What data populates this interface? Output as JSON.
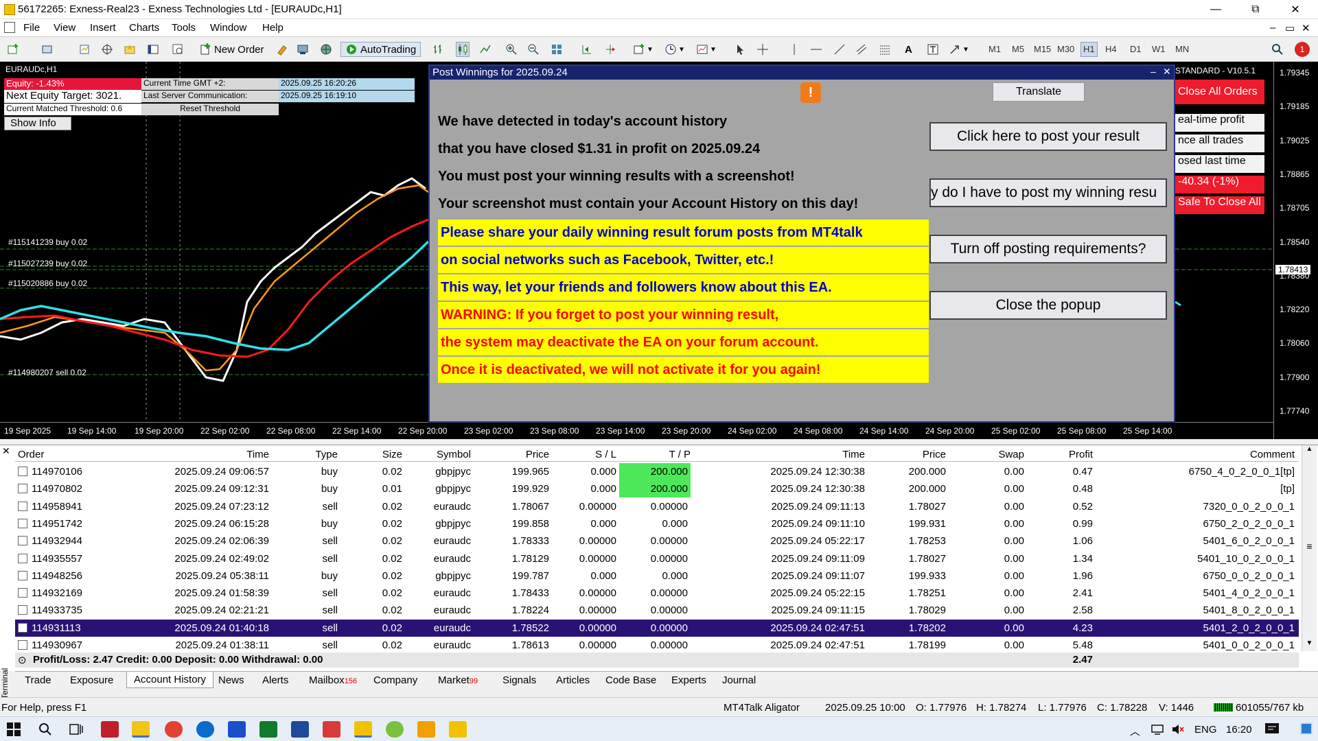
{
  "window": {
    "title": "56172265: Exness-Real23 - Exness Technologies Ltd - [EURAUDc,H1]",
    "buttons": [
      "—",
      "⧉",
      "✕"
    ]
  },
  "menu": [
    "File",
    "View",
    "Insert",
    "Charts",
    "Tools",
    "Window",
    "Help"
  ],
  "toolbar": {
    "new_order": "New Order",
    "autotrading": "AutoTrading",
    "timeframes": [
      "M1",
      "M5",
      "M15",
      "M30",
      "H1",
      "H4",
      "D1",
      "W1",
      "MN"
    ],
    "active_timeframe": "H1",
    "notification_count": "1"
  },
  "chart": {
    "symbol": "EURAUDc,H1",
    "equity": "Equity: -1.43%",
    "next_equity_target": "Next Equity Target: 3021.",
    "matched_threshold": "Current Matched Threshold: 0.6",
    "show_info": "Show Info",
    "current_time_label": "Current Time GMT +2:",
    "current_time_value": "2025.09.25 16:20:26",
    "last_server_label": "Last Server Communication:",
    "last_server_value": "2025.09.25 16:19:10",
    "reset_threshold": "Reset Threshold",
    "trade_labels": [
      "#115141239 buy 0.02",
      "#115027239 buy 0.02",
      "#115020886 buy 0.02",
      "#114980207 sell 0.02"
    ],
    "ea_version": "STANDARD - V10.5.1",
    "side_buttons": [
      "Close All Orders",
      "eal-time profit",
      "nce all trades",
      "osed last time",
      "-40.34 (-1%)",
      "Safe To Close All"
    ],
    "price_labels": [
      "1.79345",
      "1.79185",
      "1.79025",
      "1.78865",
      "1.78705",
      "1.78540",
      "1.78413",
      "1.78380",
      "1.78220",
      "1.78060",
      "1.77900",
      "1.77740"
    ],
    "current_price": "1.78413",
    "date_labels": [
      "19 Sep 2025",
      "19 Sep 14:00",
      "19 Sep 20:00",
      "22 Sep 02:00",
      "22 Sep 08:00",
      "22 Sep 14:00",
      "22 Sep 20:00",
      "23 Sep 02:00",
      "23 Sep 08:00",
      "23 Sep 14:00",
      "23 Sep 20:00",
      "24 Sep 02:00",
      "24 Sep 08:00",
      "24 Sep 14:00",
      "24 Sep 20:00",
      "25 Sep 02:00",
      "25 Sep 08:00",
      "25 Sep 14:00"
    ]
  },
  "popup": {
    "title": "Post Winnings for 2025.09.24",
    "translate": "Translate",
    "lines": [
      "We have detected in today's account history",
      "that you have closed $1.31 in profit on 2025.09.24",
      "You must post your winning results with a screenshot!",
      "Your screenshot must contain your Account History on this day!"
    ],
    "blue_lines": [
      "Please share your daily winning result forum posts from MT4talk",
      "on social networks such as Facebook, Twitter, etc.!",
      "This way, let your friends and followers know about this EA."
    ],
    "red_lines": [
      "WARNING: If you forget to post your winning result,",
      "the system may deactivate the EA on your forum account.",
      "Once it is deactivated, we will not activate it for you again!"
    ],
    "buttons": {
      "post": "Click here to post your result",
      "why": "y do I have to post my winning resu",
      "turn_off": "Turn off posting requirements?",
      "close": "Close the popup"
    }
  },
  "table": {
    "headers": [
      "Order",
      "Time",
      "Type",
      "Size",
      "Symbol",
      "Price",
      "S / L",
      "T / P",
      "Time",
      "Price",
      "Swap",
      "Profit",
      "Comment"
    ],
    "rows": [
      [
        "114970106",
        "2025.09.24 09:06:57",
        "buy",
        "0.02",
        "gbpjpyc",
        "199.965",
        "0.000",
        "200.000",
        "2025.09.24 12:30:38",
        "200.000",
        "0.00",
        "0.47",
        "6750_4_0_2_0_0_1[tp]"
      ],
      [
        "114970802",
        "2025.09.24 09:12:31",
        "buy",
        "0.01",
        "gbpjpyc",
        "199.929",
        "0.000",
        "200.000",
        "2025.09.24 12:30:38",
        "200.000",
        "0.00",
        "0.48",
        "[tp]"
      ],
      [
        "114958941",
        "2025.09.24 07:23:12",
        "sell",
        "0.02",
        "euraudc",
        "1.78067",
        "0.00000",
        "0.00000",
        "2025.09.24 09:11:13",
        "1.78027",
        "0.00",
        "0.52",
        "7320_0_0_2_0_0_1"
      ],
      [
        "114951742",
        "2025.09.24 06:15:28",
        "buy",
        "0.02",
        "gbpjpyc",
        "199.858",
        "0.000",
        "0.000",
        "2025.09.24 09:11:10",
        "199.931",
        "0.00",
        "0.99",
        "6750_2_0_2_0_0_1"
      ],
      [
        "114932944",
        "2025.09.24 02:06:39",
        "sell",
        "0.02",
        "euraudc",
        "1.78333",
        "0.00000",
        "0.00000",
        "2025.09.24 05:22:17",
        "1.78253",
        "0.00",
        "1.06",
        "5401_6_0_2_0_0_1"
      ],
      [
        "114935557",
        "2025.09.24 02:49:02",
        "sell",
        "0.02",
        "euraudc",
        "1.78129",
        "0.00000",
        "0.00000",
        "2025.09.24 09:11:09",
        "1.78027",
        "0.00",
        "1.34",
        "5401_10_0_2_0_0_1"
      ],
      [
        "114948256",
        "2025.09.24 05:38:11",
        "buy",
        "0.02",
        "gbpjpyc",
        "199.787",
        "0.000",
        "0.000",
        "2025.09.24 09:11:07",
        "199.933",
        "0.00",
        "1.96",
        "6750_0_0_2_0_0_1"
      ],
      [
        "114932169",
        "2025.09.24 01:58:39",
        "sell",
        "0.02",
        "euraudc",
        "1.78433",
        "0.00000",
        "0.00000",
        "2025.09.24 05:22:15",
        "1.78251",
        "0.00",
        "2.41",
        "5401_4_0_2_0_0_1"
      ],
      [
        "114933735",
        "2025.09.24 02:21:21",
        "sell",
        "0.02",
        "euraudc",
        "1.78224",
        "0.00000",
        "0.00000",
        "2025.09.24 09:11:15",
        "1.78029",
        "0.00",
        "2.58",
        "5401_8_0_2_0_0_1"
      ],
      [
        "114931113",
        "2025.09.24 01:40:18",
        "sell",
        "0.02",
        "euraudc",
        "1.78522",
        "0.00000",
        "0.00000",
        "2025.09.24 02:47:51",
        "1.78202",
        "0.00",
        "4.23",
        "5401_2_0_2_0_0_1"
      ],
      [
        "114930967",
        "2025.09.24 01:38:11",
        "sell",
        "0.02",
        "euraudc",
        "1.78613",
        "0.00000",
        "0.00000",
        "2025.09.24 02:47:51",
        "1.78199",
        "0.00",
        "5.48",
        "5401_0_0_2_0_0_1"
      ]
    ],
    "summary_text": "Profit/Loss: 2.47  Credit: 0.00  Deposit: 0.00  Withdrawal: 0.00",
    "summary_total": "2.47"
  },
  "terminal_tabs": [
    {
      "label": "Trade"
    },
    {
      "label": "Exposure"
    },
    {
      "label": "Account History"
    },
    {
      "label": "News"
    },
    {
      "label": "Alerts"
    },
    {
      "label": "Mailbox",
      "badge": "156"
    },
    {
      "label": "Company"
    },
    {
      "label": "Market",
      "badge": "99"
    },
    {
      "label": "Signals"
    },
    {
      "label": "Articles"
    },
    {
      "label": "Code Base"
    },
    {
      "label": "Experts"
    },
    {
      "label": "Journal"
    }
  ],
  "terminal_label": "Terminal",
  "status": {
    "help": "For Help, press F1",
    "template": "MT4Talk Aligator",
    "datetime": "2025.09.25 10:00",
    "open": "O: 1.77976",
    "high": "H: 1.78274",
    "low": "L: 1.77976",
    "close": "C: 1.78228",
    "volume": "V: 1446",
    "traffic": "601055/767 kb"
  },
  "taskbar": {
    "lang": "ENG",
    "time": "16:20"
  },
  "colors": {
    "popup_title": "#16246e",
    "highlight_yellow": "#ffff00",
    "warning_red": "#ff0000",
    "share_blue": "#0000cc",
    "selected_row": "#2a1175",
    "tp_green": "#4de85a"
  }
}
